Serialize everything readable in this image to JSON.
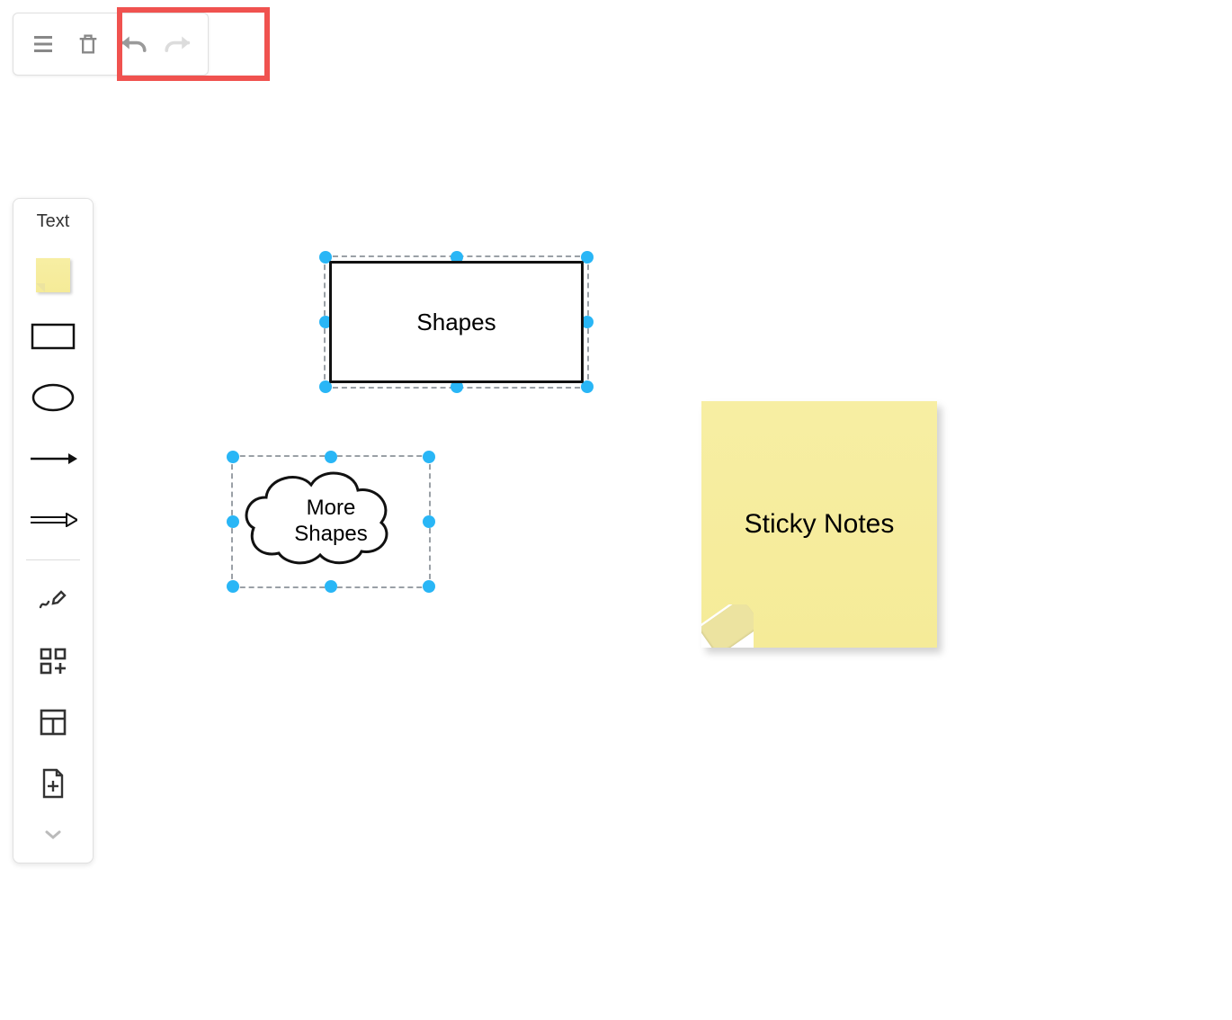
{
  "toolbar": {
    "menu_icon": "menu",
    "delete_icon": "delete",
    "undo_icon": "undo",
    "redo_icon": "redo"
  },
  "palette": {
    "text_label": "Text",
    "items": {
      "sticky": "sticky-note",
      "rect": "rectangle",
      "ellipse": "ellipse",
      "arrow": "arrow-right",
      "open_arrow": "open-arrow-right",
      "freehand": "freehand",
      "add_shapes": "add-shapes",
      "table": "table",
      "new_page": "new-page",
      "more": "chevron-down"
    }
  },
  "canvas": {
    "rect1": {
      "label": "Shapes"
    },
    "cloud1": {
      "line1": "More",
      "line2": "Shapes"
    },
    "sticky1": {
      "label": "Sticky Notes"
    }
  },
  "colors": {
    "selection_handle": "#29b6f6",
    "highlight_border": "#f0524f",
    "sticky_bg": "#f5eb98"
  }
}
